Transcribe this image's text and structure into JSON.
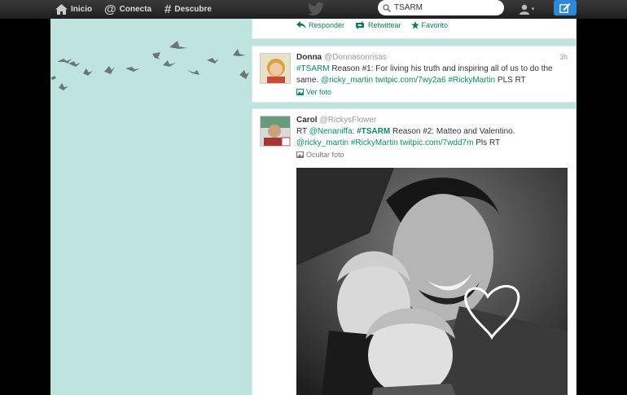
{
  "nav": {
    "home_label": "Inicio",
    "connect_label": "Conecta",
    "discover_label": "Descubre"
  },
  "search": {
    "value": "TSARM"
  },
  "previous_tweet_actions": {
    "reply_label": "Responder",
    "retweet_label": "Retwittear",
    "favorite_label": "Favorito"
  },
  "tweets": [
    {
      "name": "Donna",
      "handle": "@Donnasonrisas",
      "time": "3h",
      "hashtag": "#TSARM",
      "text_a": " Reason #1: For living his truth and inspiring all of us to do the same. ",
      "mention": "@ricky_martin",
      "link": " twitpic.com/7wy2a6 ",
      "hashtag2": "#RickyMartin",
      "text_b": " PLS RT",
      "photo_toggle": "Ver foto"
    },
    {
      "name": "Carol",
      "handle": "@RickysFlower",
      "text_a": "RT ",
      "mention1": "@Nenaniffa",
      "text_b": ": ",
      "hashtag": "#TSARM",
      "text_c": " Reason #2: Matteo and Valentino. ",
      "mention2": "@ricky_martin",
      "hashtag2": " #RickyMartin",
      "link": " twitpic.com/7wdd7m",
      "text_d": " Pls RT",
      "photo_toggle": "Ocultar foto"
    }
  ],
  "colors": {
    "background": "#bfe4df",
    "link": "#0b8a66",
    "topbar": "#2a2a2a",
    "compose": "#2e88d8"
  },
  "icons": [
    "home-icon",
    "at-icon",
    "hash-icon",
    "twitter-bird-icon",
    "search-icon",
    "user-icon",
    "compose-icon",
    "reply-icon",
    "retweet-icon",
    "favorite-icon",
    "photo-icon"
  ]
}
